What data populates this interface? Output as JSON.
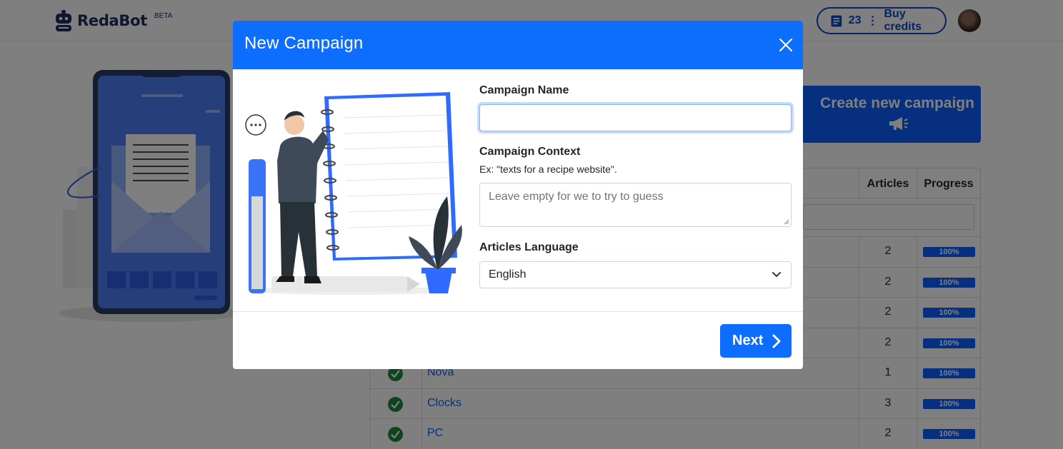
{
  "app": {
    "name": "RedaBot",
    "badge": "BETA"
  },
  "header": {
    "credits_count": "23",
    "credits_separator": "⋮",
    "credits_action": "Buy credits"
  },
  "main": {
    "create_button_label": "Create new campaign"
  },
  "table": {
    "columns": [
      "Articles",
      "Progress"
    ],
    "rows": [
      {
        "name": "",
        "articles": "2",
        "progress": "100%"
      },
      {
        "name": "",
        "articles": "2",
        "progress": "100%"
      },
      {
        "name": "",
        "articles": "2",
        "progress": "100%"
      },
      {
        "name": "",
        "articles": "2",
        "progress": "100%"
      },
      {
        "name": "Nova",
        "articles": "1",
        "progress": "100%"
      },
      {
        "name": "Clocks",
        "articles": "3",
        "progress": "100%"
      },
      {
        "name": "PC",
        "articles": "2",
        "progress": "100%"
      }
    ]
  },
  "modal": {
    "title": "New Campaign",
    "campaign_name_label": "Campaign Name",
    "campaign_name_value": "",
    "campaign_context_label": "Campaign Context",
    "campaign_context_hint": "Ex: \"texts for a recipe website\".",
    "campaign_context_placeholder": "Leave empty for we to try to guess",
    "language_label": "Articles Language",
    "language_value": "English",
    "next_label": "Next"
  },
  "colors": {
    "primary": "#0d6efd",
    "brand_dark": "#1f2d5a",
    "success": "#1e8a3c"
  }
}
